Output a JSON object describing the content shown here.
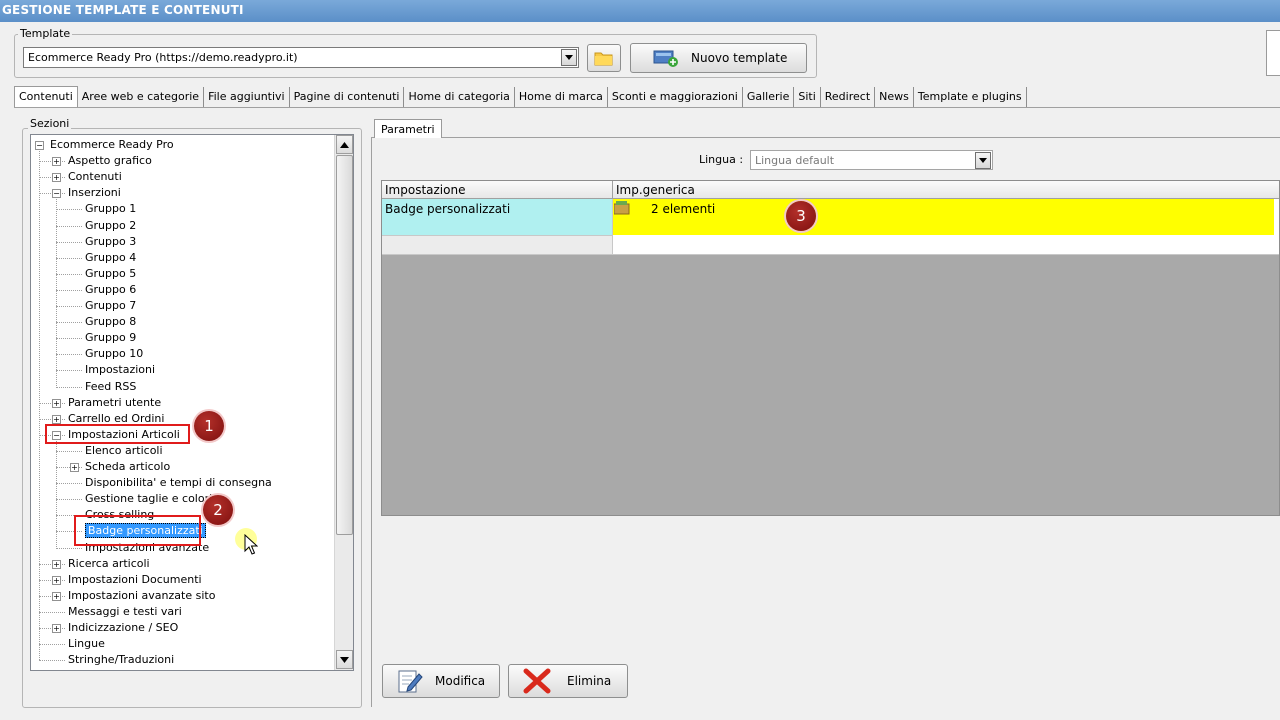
{
  "window": {
    "title": "GESTIONE TEMPLATE E CONTENUTI"
  },
  "template_group": {
    "label": "Template",
    "selected": "Ecommerce Ready Pro (https://demo.readypro.it)",
    "folder_icon": "folder-icon",
    "new_button": "Nuovo template"
  },
  "tabs": [
    "Contenuti",
    "Aree web e categorie",
    "File aggiuntivi",
    "Pagine di contenuti",
    "Home di categoria",
    "Home di marca",
    "Sconti e maggiorazioni",
    "Gallerie",
    "Siti",
    "Redirect",
    "News",
    "Template e plugins"
  ],
  "sections": {
    "label": "Sezioni",
    "tree": [
      {
        "label": "Ecommerce Ready Pro",
        "level": 0,
        "exp": "-"
      },
      {
        "label": "Aspetto grafico",
        "level": 1,
        "exp": "+"
      },
      {
        "label": "Contenuti",
        "level": 1,
        "exp": "+"
      },
      {
        "label": "Inserzioni",
        "level": 1,
        "exp": "-"
      },
      {
        "label": "Gruppo 1",
        "level": 2,
        "exp": ""
      },
      {
        "label": "Gruppo 2",
        "level": 2,
        "exp": ""
      },
      {
        "label": "Gruppo 3",
        "level": 2,
        "exp": ""
      },
      {
        "label": "Gruppo 4",
        "level": 2,
        "exp": ""
      },
      {
        "label": "Gruppo 5",
        "level": 2,
        "exp": ""
      },
      {
        "label": "Gruppo 6",
        "level": 2,
        "exp": ""
      },
      {
        "label": "Gruppo 7",
        "level": 2,
        "exp": ""
      },
      {
        "label": "Gruppo 8",
        "level": 2,
        "exp": ""
      },
      {
        "label": "Gruppo 9",
        "level": 2,
        "exp": ""
      },
      {
        "label": "Gruppo 10",
        "level": 2,
        "exp": ""
      },
      {
        "label": "Impostazioni",
        "level": 2,
        "exp": ""
      },
      {
        "label": "Feed RSS",
        "level": 2,
        "exp": ""
      },
      {
        "label": "Parametri utente",
        "level": 1,
        "exp": "+"
      },
      {
        "label": "Carrello ed Ordini",
        "level": 1,
        "exp": "+"
      },
      {
        "label": "Impostazioni Articoli",
        "level": 1,
        "exp": "-"
      },
      {
        "label": "Elenco articoli",
        "level": 2,
        "exp": ""
      },
      {
        "label": "Scheda articolo",
        "level": 2,
        "exp": "+"
      },
      {
        "label": "Disponibilita' e tempi di consegna",
        "level": 2,
        "exp": ""
      },
      {
        "label": "Gestione taglie e colori",
        "level": 2,
        "exp": ""
      },
      {
        "label": "Cross selling",
        "level": 2,
        "exp": ""
      },
      {
        "label": "Badge personalizzati",
        "level": 2,
        "exp": "",
        "selected": true
      },
      {
        "label": "Impostazioni avanzate",
        "level": 2,
        "exp": ""
      },
      {
        "label": "Ricerca articoli",
        "level": 1,
        "exp": "+"
      },
      {
        "label": "Impostazioni Documenti",
        "level": 1,
        "exp": "+"
      },
      {
        "label": "Impostazioni avanzate sito",
        "level": 1,
        "exp": "+"
      },
      {
        "label": "Messaggi e testi vari",
        "level": 1,
        "exp": ""
      },
      {
        "label": "Indicizzazione / SEO",
        "level": 1,
        "exp": "+"
      },
      {
        "label": "Lingue",
        "level": 1,
        "exp": ""
      },
      {
        "label": "Stringhe/Traduzioni",
        "level": 1,
        "exp": ""
      }
    ]
  },
  "annotations": {
    "one": "1",
    "two": "2",
    "three": "3"
  },
  "params": {
    "tab": "Parametri",
    "language_label": "Lingua :",
    "language_value": "Lingua default",
    "col1": "Impostazione",
    "col2": "Imp.generica",
    "row_setting": "Badge personalizzati",
    "row_value": "2 elementi"
  },
  "buttons": {
    "edit": "Modifica",
    "delete": "Elimina"
  },
  "colors": {
    "highlight_yellow": "#ffff00",
    "setting_cell": "#b0f0f0",
    "annotation_red": "#e01b1b"
  }
}
